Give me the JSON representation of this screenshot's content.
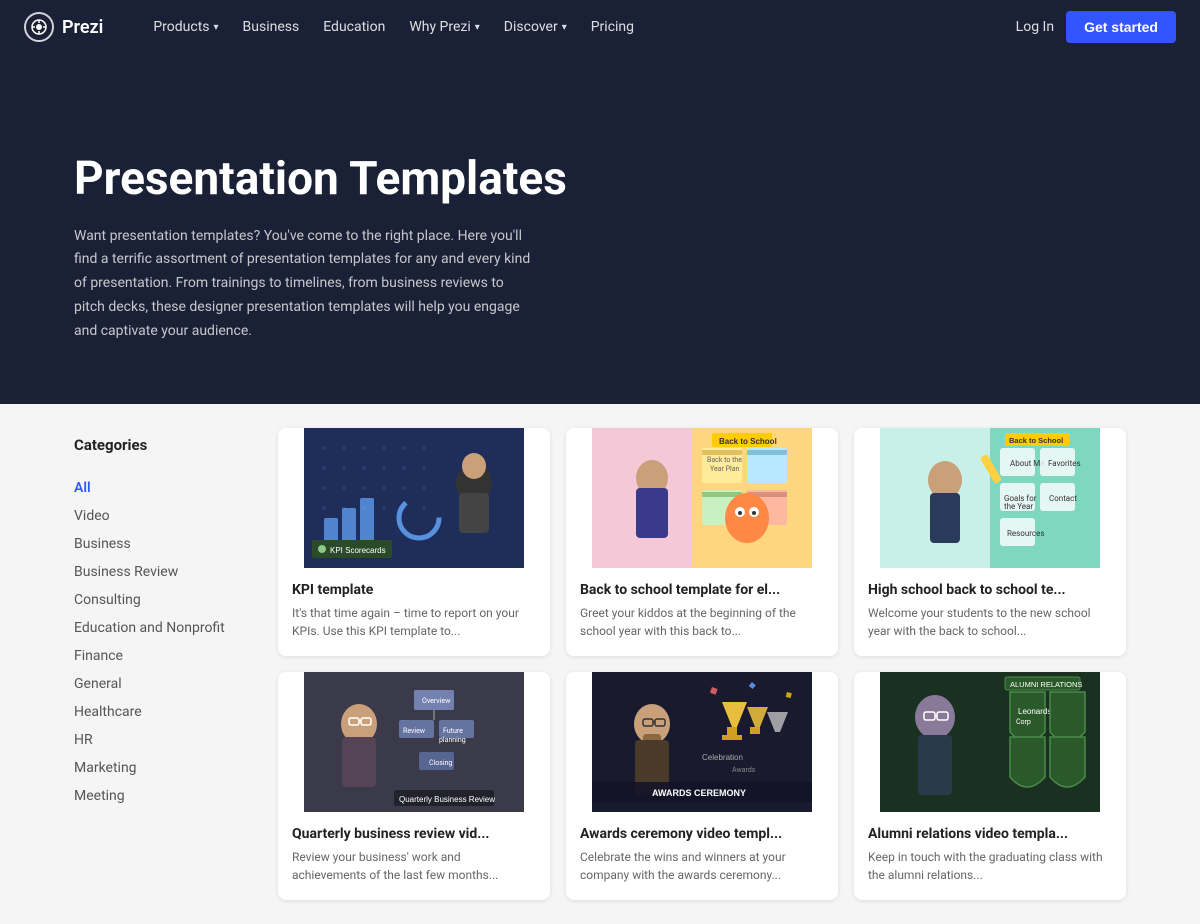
{
  "nav": {
    "logo_text": "Prezi",
    "links": [
      {
        "label": "Products",
        "has_dropdown": true
      },
      {
        "label": "Business",
        "has_dropdown": false
      },
      {
        "label": "Education",
        "has_dropdown": false
      },
      {
        "label": "Why Prezi",
        "has_dropdown": true
      },
      {
        "label": "Discover",
        "has_dropdown": true
      },
      {
        "label": "Pricing",
        "has_dropdown": false
      }
    ],
    "login_label": "Log In",
    "cta_label": "Get started"
  },
  "hero": {
    "title": "Presentation Templates",
    "description": "Want presentation templates? You've come to the right place. Here you'll find a terrific assortment of presentation templates for any and every kind of presentation. From trainings to timelines, from business reviews to pitch decks, these designer presentation templates will help you engage and captivate your audience."
  },
  "sidebar": {
    "title": "Categories",
    "items": [
      {
        "label": "All",
        "active": true
      },
      {
        "label": "Video"
      },
      {
        "label": "Business"
      },
      {
        "label": "Business Review"
      },
      {
        "label": "Consulting"
      },
      {
        "label": "Education and Nonprofit"
      },
      {
        "label": "Finance"
      },
      {
        "label": "General"
      },
      {
        "label": "Healthcare"
      },
      {
        "label": "HR"
      },
      {
        "label": "Marketing"
      },
      {
        "label": "Meeting"
      }
    ]
  },
  "templates": [
    {
      "title": "KPI template",
      "description": "It's that time again – time to report on your KPIs. Use this KPI template to...",
      "thumb_type": "kpi",
      "badge": "KPI  Scorecards"
    },
    {
      "title": "Back to school template for el...",
      "description": "Greet your kiddos at the beginning of the school year with this back to...",
      "thumb_type": "school",
      "badge": "Back to School"
    },
    {
      "title": "High school back to school te...",
      "description": "Welcome your students to the new school year with the back to school...",
      "thumb_type": "highschool",
      "badge": "Back to School"
    },
    {
      "title": "Quarterly business review vid...",
      "description": "Review your business' work and achievements of the last few months...",
      "thumb_type": "quarterly",
      "badge": "Quarterly Business Review"
    },
    {
      "title": "Awards ceremony video templ...",
      "description": "Celebrate the wins and winners at your company with the awards ceremony...",
      "thumb_type": "awards",
      "badge": "AWARDS CEREMONY"
    },
    {
      "title": "Alumni relations video templa...",
      "description": "Keep in touch with the graduating class with the alumni relations...",
      "thumb_type": "alumni",
      "badge": "ALUMNI RELATIONS"
    }
  ],
  "colors": {
    "nav_bg": "#1a2035",
    "cta_bg": "#3355ff",
    "active_link": "#3355ff"
  }
}
